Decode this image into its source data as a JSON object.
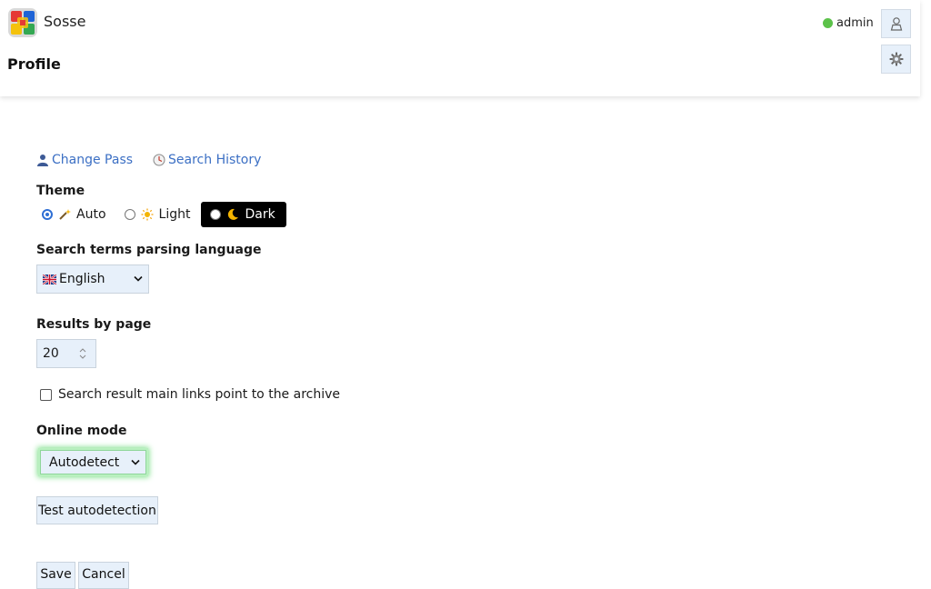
{
  "app": {
    "name": "Sosse"
  },
  "header": {
    "page_title": "Profile",
    "username": "admin",
    "status_color": "#5cc24a"
  },
  "links": {
    "change_pass": "Change Pass",
    "search_history": "Search History"
  },
  "theme": {
    "label": "Theme",
    "options": [
      {
        "label": "Auto",
        "icon": "wand-icon",
        "checked": true
      },
      {
        "label": "Light",
        "icon": "sun-icon",
        "checked": false
      },
      {
        "label": "Dark",
        "icon": "moon-icon",
        "checked": false
      }
    ]
  },
  "language": {
    "label": "Search terms parsing language",
    "selected": "English",
    "flag": "uk-flag-icon"
  },
  "results": {
    "label": "Results by page",
    "value": "20"
  },
  "archive_links": {
    "label": "Search result main links point to the archive",
    "checked": false
  },
  "online_mode": {
    "label": "Online mode",
    "selected": "Autodetect"
  },
  "buttons": {
    "test": "Test autodetection",
    "save": "Save",
    "cancel": "Cancel"
  },
  "colors": {
    "accent": "#2f6fd4",
    "link": "#3b6fc4",
    "field_bg": "#e7f0fa",
    "focus_glow": "#7ee08a"
  }
}
